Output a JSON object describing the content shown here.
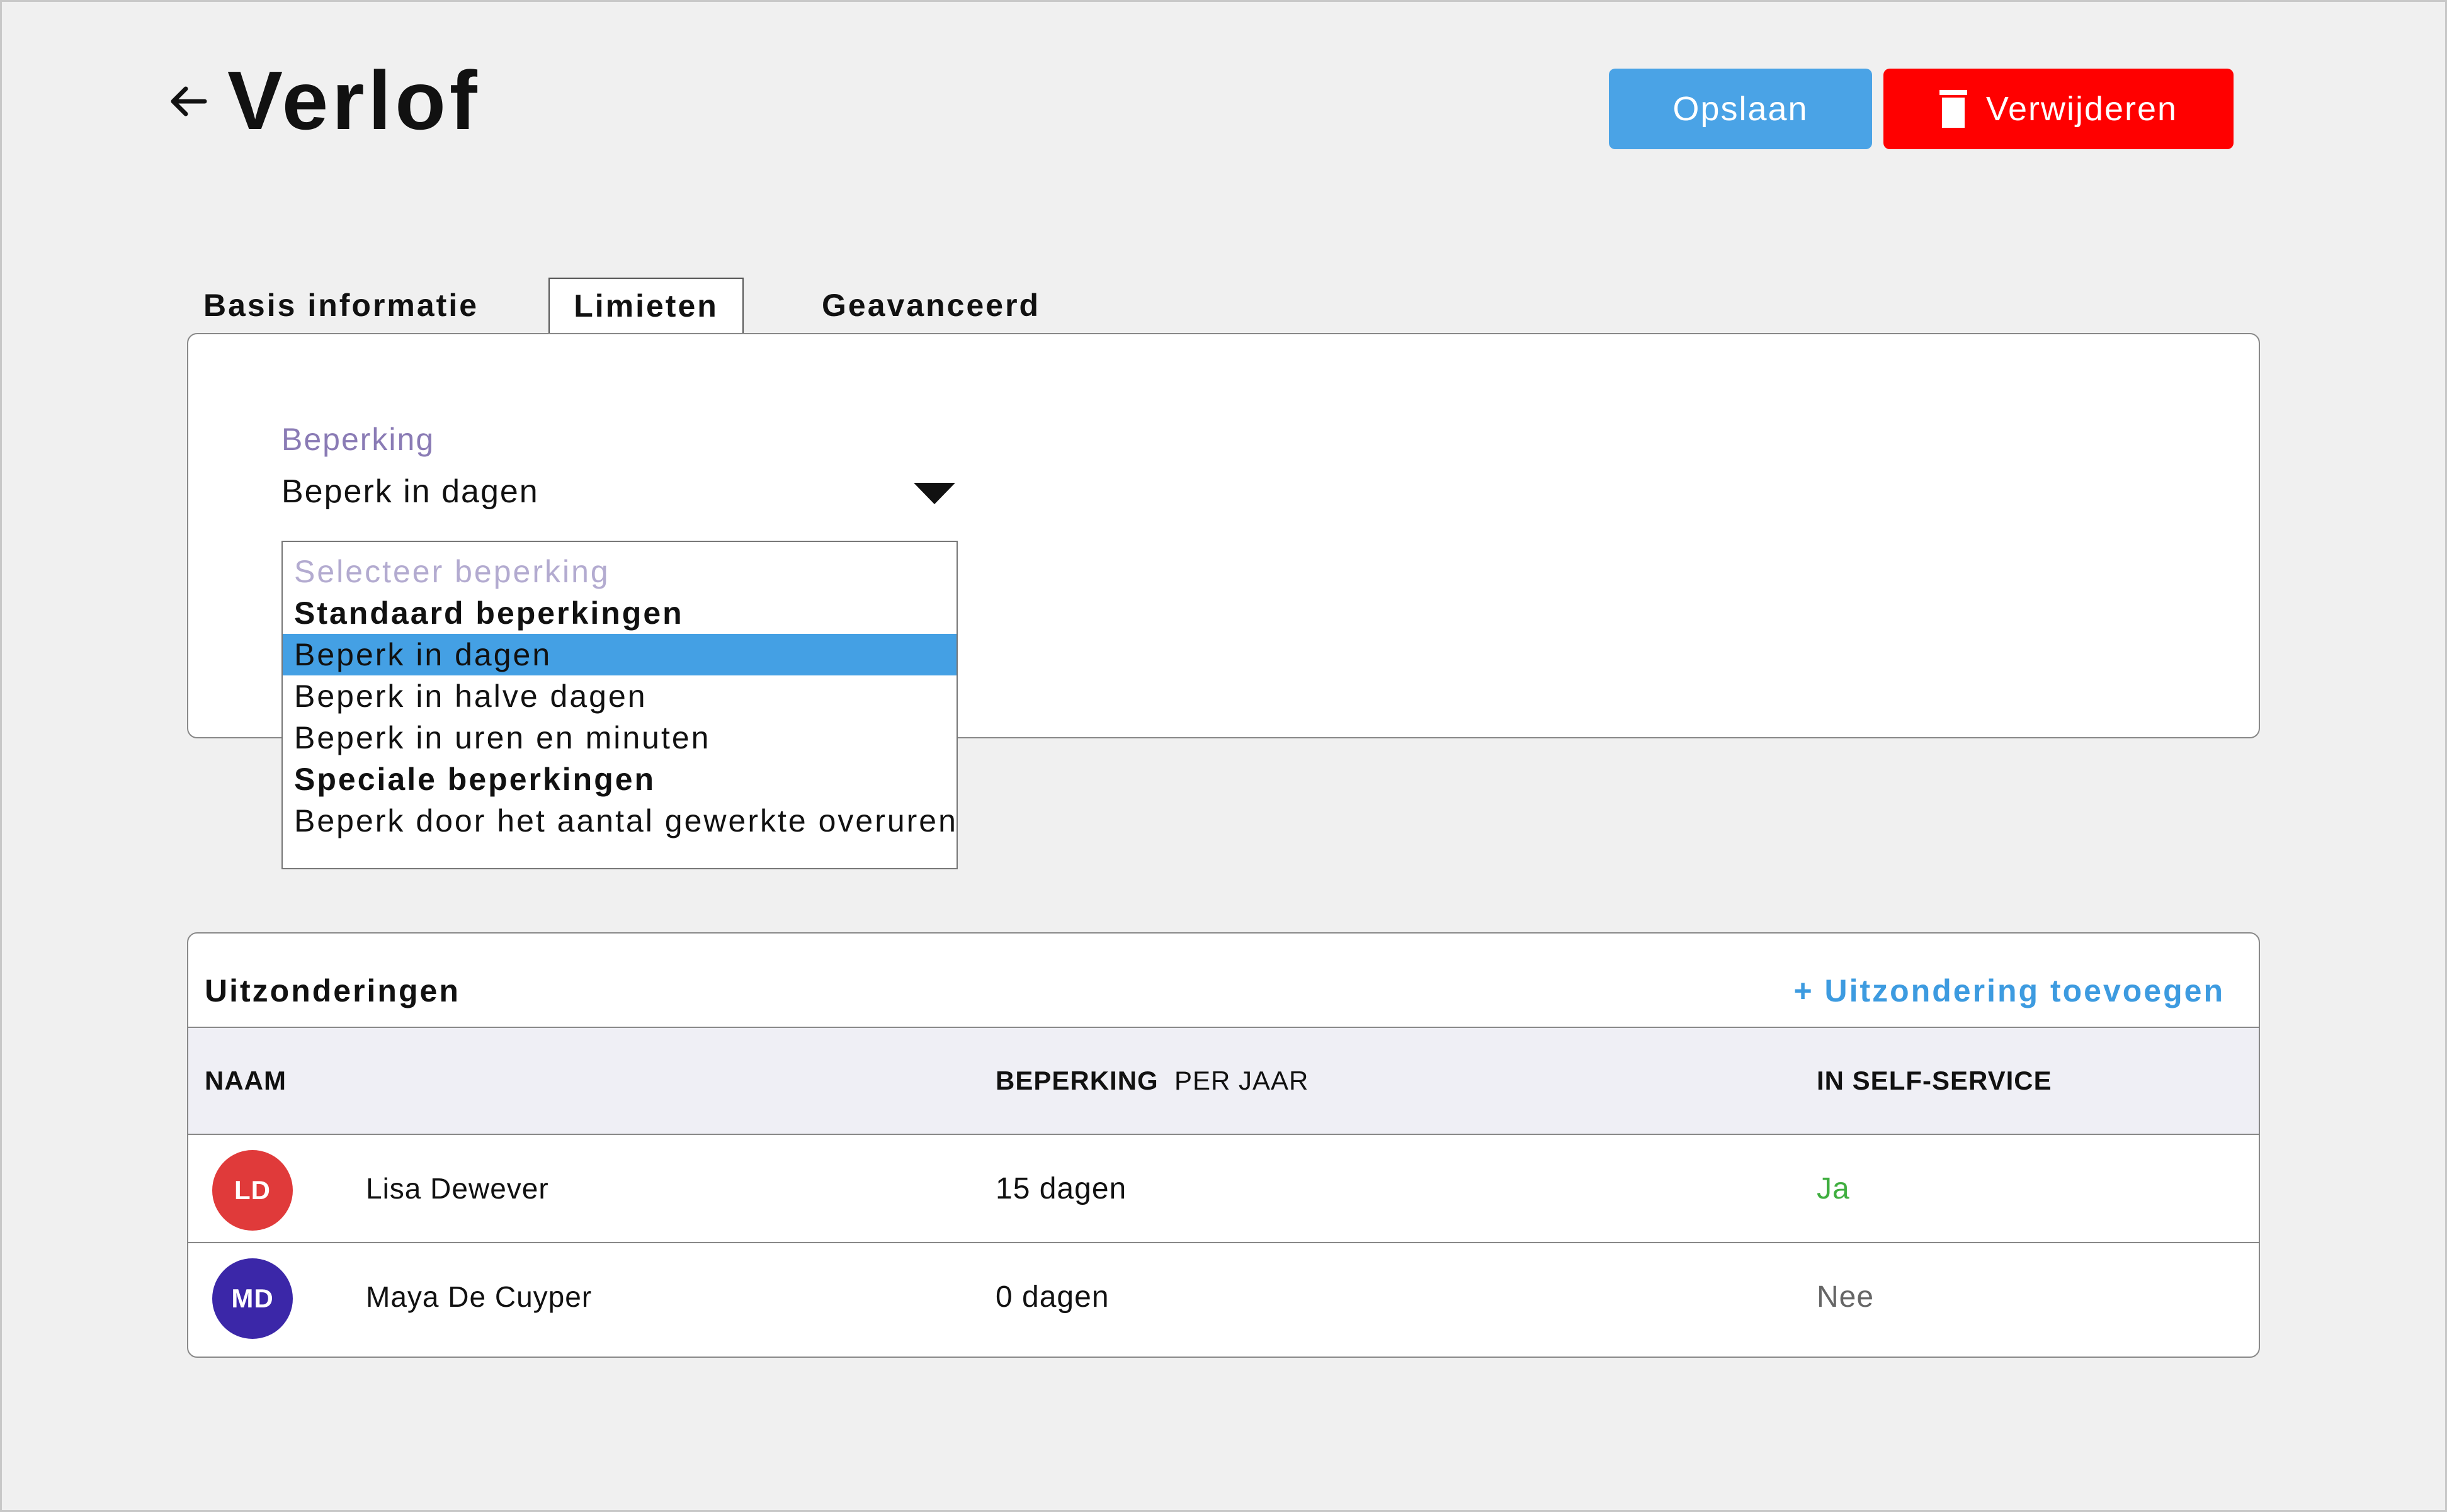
{
  "header": {
    "title": "Verlof",
    "save_label": "Opslaan",
    "delete_label": "Verwijderen"
  },
  "tabs": [
    {
      "label": "Basis informatie",
      "active": false
    },
    {
      "label": "Limieten",
      "active": true
    },
    {
      "label": "Geavanceerd",
      "active": false
    }
  ],
  "limits": {
    "field_label": "Beperking",
    "selected_value": "Beperk in dagen",
    "dropdown": {
      "placeholder": "Selecteer beperking",
      "groups": [
        {
          "label": "Standaard beperkingen",
          "options": [
            "Beperk in dagen",
            "Beperk in halve dagen",
            "Beperk in uren en minuten"
          ]
        },
        {
          "label": "Speciale beperkingen",
          "options": [
            "Beperk door het aantal gewerkte overuren"
          ]
        }
      ],
      "highlighted": "Beperk in dagen"
    }
  },
  "exceptions": {
    "title": "Uitzonderingen",
    "add_label": "+ Uitzondering toevoegen",
    "columns": {
      "name": "NAAM",
      "limit": "BEPERKING",
      "limit_sub": "PER JAAR",
      "self_service": "IN SELF-SERVICE"
    },
    "rows": [
      {
        "initials": "LD",
        "avatar_color": "#e03a3a",
        "name": "Lisa Dewever",
        "limit": "15 dagen",
        "self_service": "Ja",
        "self_service_color": "#3fae3f"
      },
      {
        "initials": "MD",
        "avatar_color": "#3b27a8",
        "name": "Maya De Cuyper",
        "limit": "0 dagen",
        "self_service": "Nee",
        "self_service_color": "#666666"
      }
    ]
  },
  "colors": {
    "primary": "#4aa3e6",
    "danger": "#ff0000",
    "label_purple": "#8a7bb5",
    "selection": "#44a0e4"
  }
}
